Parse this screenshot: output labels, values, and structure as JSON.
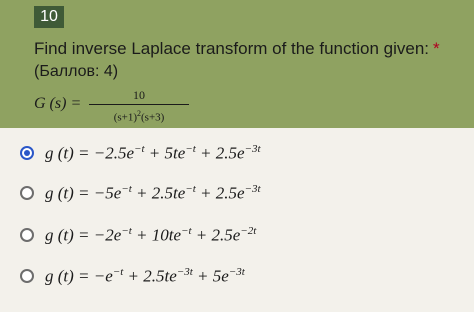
{
  "question": {
    "number": "10",
    "title": "Find inverse Laplace transform of the function given:",
    "required_mark": "*",
    "points": "(Баллов: 4)",
    "formula": {
      "lhs": "G (s)  =",
      "numerator": "10",
      "denominator_base": "(s+1)",
      "denominator_exp": "2",
      "denominator_tail": "(s+3)"
    }
  },
  "options": [
    {
      "selected": true,
      "parts": [
        "g (t)  = −2.5e",
        "−t",
        " + 5te",
        "−t",
        " + 2.5e",
        "−3t",
        ""
      ]
    },
    {
      "selected": false,
      "parts": [
        "g (t)  = −5e",
        "−t",
        " + 2.5te",
        "−t",
        " + 2.5e",
        "−3t",
        ""
      ]
    },
    {
      "selected": false,
      "parts": [
        "g (t)  = −2e",
        "−t",
        " + 10te",
        "−t",
        " + 2.5e",
        "−2t",
        ""
      ]
    },
    {
      "selected": false,
      "parts": [
        "g (t)  = −e",
        "−t",
        " + 2.5te",
        "−3t",
        " + 5e",
        "−3t",
        ""
      ]
    }
  ],
  "colors": {
    "header_bg": "#8fa261",
    "number_badge": "#3f5a37",
    "radio_selected": "#2a57c8"
  }
}
